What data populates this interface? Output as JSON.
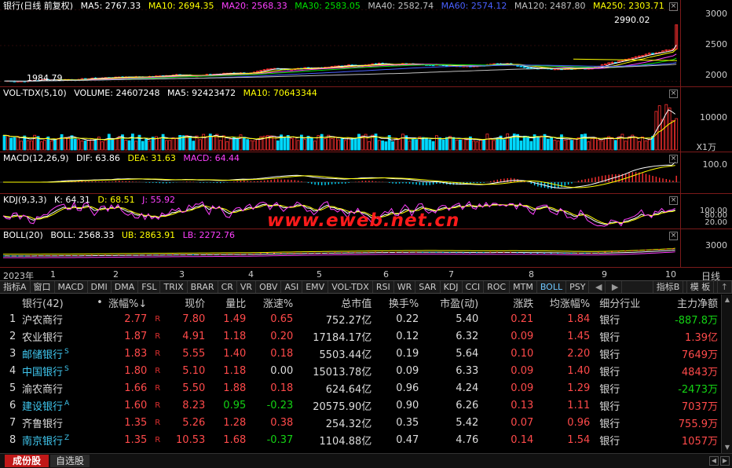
{
  "colors": {
    "up": "#ff4a4a",
    "down": "#14d214",
    "ma5": "#ffffff",
    "ma10": "#ffff00",
    "ma20": "#ff40ff",
    "ma30": "#00ff00",
    "ma40": "#c0c0c0",
    "ma60": "#4040ff",
    "ma120": "#c0c0c0",
    "ma250": "#ffff00"
  },
  "price": {
    "title": "银行(日线 前复权)",
    "ma5": "MA5: 2767.33",
    "ma10": "MA10: 2694.35",
    "ma20": "MA20: 2568.33",
    "ma30": "MA30: 2583.05",
    "ma40": "MA40: 2582.74",
    "ma60": "MA60: 2574.12",
    "ma120": "MA120: 2487.80",
    "ma250": "MA250: 2303.71",
    "high_label": "2990.02",
    "low_label": "1984.79",
    "axis": [
      "3000",
      "2500",
      "2000"
    ]
  },
  "volume": {
    "title": "VOL-TDX(5,10)",
    "vol": "VOLUME: 24607248",
    "ma5": "MA5: 92423472",
    "ma10": "MA10: 70643344",
    "axis": [
      "10000",
      "X1万"
    ]
  },
  "macd": {
    "title": "MACD(12,26,9)",
    "dif": "DIF: 63.86",
    "dea": "DEA: 31.63",
    "macd": "MACD: 64.44",
    "axis": [
      "100.0"
    ]
  },
  "kdj": {
    "title": "KDJ(9,3,3)",
    "k": "K: 64.31",
    "d": "D: 68.51",
    "j": "J: 55.92",
    "axis": [
      "100.00",
      "80.00",
      "20.00"
    ]
  },
  "boll": {
    "title": "BOLL(20)",
    "boll": "BOLL: 2568.33",
    "ub": "UB: 2863.91",
    "lb": "LB: 2272.76",
    "axis": [
      "3000"
    ]
  },
  "watermark": "www.eweb.net.cn",
  "timeaxis": {
    "year": "2023年",
    "months": [
      "1",
      "2",
      "3",
      "4",
      "5",
      "6",
      "7",
      "8",
      "9",
      "10"
    ],
    "right": "日线"
  },
  "tabs": [
    "指标A",
    "窗口",
    "MACD",
    "DMI",
    "DMA",
    "FSL",
    "TRIX",
    "BRAR",
    "CR",
    "VR",
    "OBV",
    "ASI",
    "EMV",
    "VOL-TDX",
    "RSI",
    "WR",
    "SAR",
    "KDJ",
    "CCI",
    "ROC",
    "MTM",
    "BOLL",
    "PSY"
  ],
  "tabs_active": "BOLL",
  "tabs_right": [
    "指标B",
    "模 板"
  ],
  "table": {
    "headers": [
      "",
      "银行(42)",
      "•",
      "涨幅%↓",
      "",
      "现价",
      "量比",
      "涨速%",
      "总市值",
      "换手%",
      "市盈(动)",
      "涨跌",
      "均涨幅%",
      "细分行业",
      "主力净额"
    ],
    "rows": [
      {
        "idx": "1",
        "name": "沪农商行",
        "sup": "",
        "r": "R",
        "chg": "2.77",
        "price": "7.80",
        "vr": "1.49",
        "spd": "0.65",
        "cap": "752.27亿",
        "turn": "0.22",
        "pe": "5.40",
        "diff": "0.21",
        "avg": "1.84",
        "ind": "银行",
        "net": "-887.8万"
      },
      {
        "idx": "2",
        "name": "农业银行",
        "sup": "",
        "r": "R",
        "chg": "1.87",
        "price": "4.91",
        "vr": "1.18",
        "spd": "0.20",
        "cap": "17184.17亿",
        "turn": "0.12",
        "pe": "6.32",
        "diff": "0.09",
        "avg": "1.45",
        "ind": "银行",
        "net": "1.39亿"
      },
      {
        "idx": "3",
        "name": "邮储银行",
        "sup": "S",
        "r": "R",
        "chg": "1.83",
        "price": "5.55",
        "vr": "1.40",
        "spd": "0.18",
        "cap": "5503.44亿",
        "turn": "0.19",
        "pe": "5.64",
        "diff": "0.10",
        "avg": "2.20",
        "ind": "银行",
        "net": "7649万"
      },
      {
        "idx": "4",
        "name": "中国银行",
        "sup": "S",
        "r": "R",
        "chg": "1.80",
        "price": "5.10",
        "vr": "1.18",
        "spd": "0.00",
        "cap": "15013.78亿",
        "turn": "0.09",
        "pe": "6.33",
        "diff": "0.09",
        "avg": "1.40",
        "ind": "银行",
        "net": "4843万"
      },
      {
        "idx": "5",
        "name": "渝农商行",
        "sup": "",
        "r": "R",
        "chg": "1.66",
        "price": "5.50",
        "vr": "1.88",
        "spd": "0.18",
        "cap": "624.64亿",
        "turn": "0.96",
        "pe": "4.24",
        "diff": "0.09",
        "avg": "1.29",
        "ind": "银行",
        "net": "-2473万"
      },
      {
        "idx": "6",
        "name": "建设银行",
        "sup": "A",
        "r": "R",
        "chg": "1.60",
        "price": "8.23",
        "vr": "0.95",
        "spd": "-0.23",
        "cap": "20575.90亿",
        "turn": "0.90",
        "pe": "6.26",
        "diff": "0.13",
        "avg": "1.11",
        "ind": "银行",
        "net": "7037万"
      },
      {
        "idx": "7",
        "name": "齐鲁银行",
        "sup": "",
        "r": "R",
        "chg": "1.35",
        "price": "5.26",
        "vr": "1.28",
        "spd": "0.38",
        "cap": "254.32亿",
        "turn": "0.35",
        "pe": "5.42",
        "diff": "0.07",
        "avg": "0.96",
        "ind": "银行",
        "net": "755.9万"
      },
      {
        "idx": "8",
        "name": "南京银行",
        "sup": "Z",
        "r": "R",
        "chg": "1.35",
        "price": "10.53",
        "vr": "1.68",
        "spd": "-0.37",
        "cap": "1104.88亿",
        "turn": "0.47",
        "pe": "4.76",
        "diff": "0.14",
        "avg": "1.54",
        "ind": "银行",
        "net": "1057万"
      }
    ]
  },
  "bottom_tabs": [
    "成份股",
    "自选股"
  ]
}
